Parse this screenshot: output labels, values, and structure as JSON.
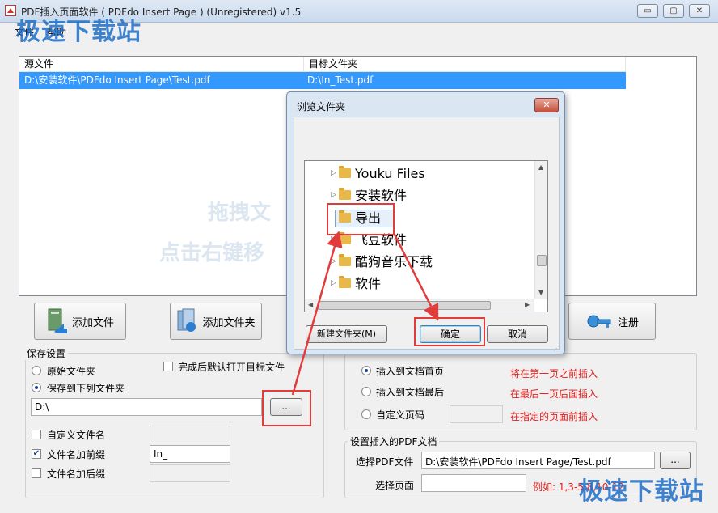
{
  "app": {
    "title": "PDF插入页面软件 ( PDFdo Insert Page )  (Unregistered) v1.5",
    "watermark": "极速下载站"
  },
  "window_controls": {
    "minimize": "▭",
    "maximize": "▢",
    "close": "✕"
  },
  "menu": {
    "file": "文件",
    "help": "帮助"
  },
  "file_list": {
    "columns": [
      "源文件",
      "目标文件夹"
    ],
    "rows": [
      {
        "source": "D:\\安装软件\\PDFdo Insert Page\\Test.pdf",
        "target": "D:\\In_Test.pdf"
      }
    ],
    "drop_hint_1": "拖拽文",
    "drop_hint_2": "点击右键移"
  },
  "buttons": {
    "add_file": "添加文件",
    "add_folder": "添加文件夹",
    "register": "注册"
  },
  "save_settings": {
    "legend": "保存设置",
    "original_folder": "原始文件夹",
    "save_to_folder": "保存到下列文件夹",
    "open_after": "完成后默认打开目标文件",
    "output_path": "D:\\",
    "browse": "...",
    "custom_name": "自定义文件名",
    "add_prefix": "文件名加前缀",
    "prefix_value": "In_",
    "add_suffix": "文件名加后缀"
  },
  "insert_settings": {
    "insert_first": "插入到文档首页",
    "insert_first_note": "将在第一页之前插入",
    "insert_last": "插入到文档最后",
    "insert_last_note": "在最后一页后面插入",
    "custom_page": "自定义页码",
    "custom_page_note": "在指定的页面前插入"
  },
  "insert_pdf": {
    "legend": "设置插入的PDF文档",
    "select_pdf_label": "选择PDF文件",
    "select_pdf_value": "D:\\安装软件\\PDFdo Insert Page/Test.pdf",
    "browse": "...",
    "select_pages_label": "选择页面",
    "example": "例如: 1,3-5,8,10-12"
  },
  "dialog": {
    "title": "浏览文件夹",
    "tree": [
      "Youku Files",
      "安装软件",
      "导出",
      "飞豆软件",
      "酷狗音乐下载",
      "软件"
    ],
    "selected": "导出",
    "new_folder": "新建文件夹(M)",
    "ok": "确定",
    "cancel": "取消"
  },
  "colors": {
    "accent": "#3399ff",
    "annotation": "#e23b3b",
    "note": "#e02020"
  }
}
